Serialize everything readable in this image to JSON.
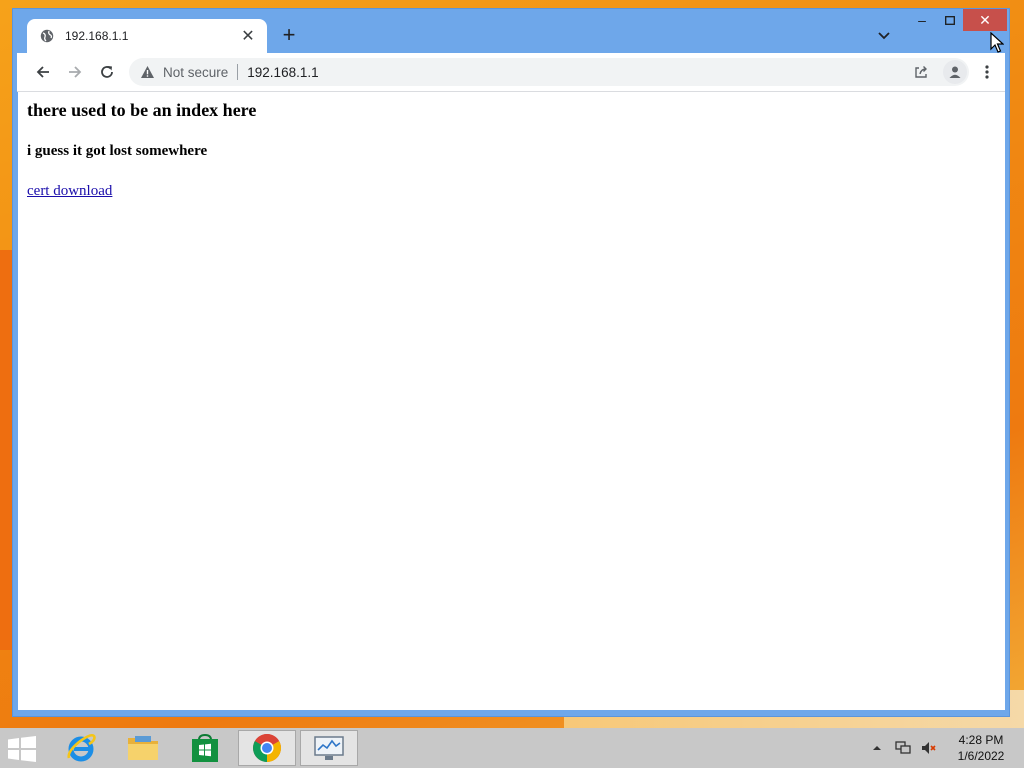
{
  "browser": {
    "tab": {
      "title": "192.168.1.1",
      "close_glyph": "✕"
    },
    "new_tab_glyph": "+",
    "omnibox": {
      "security_label": "Not secure",
      "url": "192.168.1.1"
    },
    "window_controls": {
      "minimize": "–",
      "maximize": "□",
      "close": "✕"
    }
  },
  "page": {
    "heading": "there used to be an index here",
    "subheading": "i guess it got lost somewhere",
    "link": "cert download"
  },
  "taskbar": {
    "apps": [
      "internet-explorer",
      "file-explorer",
      "store",
      "chrome",
      "performance-monitor"
    ],
    "active_app": "chrome",
    "clock": {
      "time": "4:28 PM",
      "date": "1/6/2022"
    }
  },
  "colors": {
    "window_frame": "#6ea7ea",
    "close_button": "#c7504b",
    "link": "#1a0dab",
    "desktop": "#f08a12",
    "taskbar": "#c8c8c8"
  }
}
